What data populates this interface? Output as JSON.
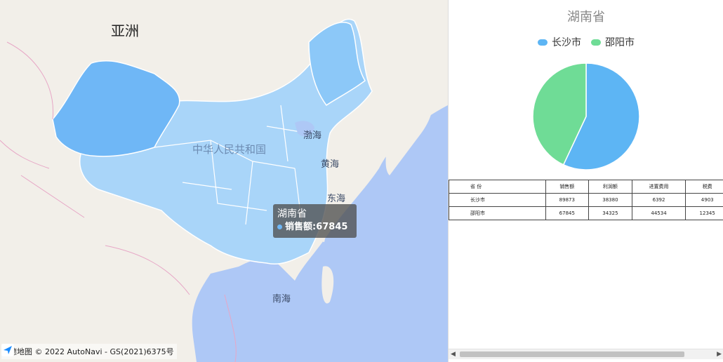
{
  "map": {
    "labels": {
      "asia": "亚洲",
      "country": "中华人民共和国",
      "bohai": "渤海",
      "yellow_sea": "黄海",
      "east_sea": "东海",
      "south_sea": "南海"
    },
    "tooltip": {
      "title": "湖南省",
      "row": "销售额:67845"
    },
    "attribution": {
      "brand": "高德地图",
      "copyright": "© 2022 AutoNavi - GS(2021)6375号"
    },
    "colors": {
      "ocean": "#aec8f6",
      "land": "#f2efe9",
      "region_light": "#a9d5f9",
      "region_dark": "#6fb7f6"
    }
  },
  "chart_data": {
    "type": "pie",
    "title": "湖南省",
    "legend": [
      "长沙市",
      "邵阳市"
    ],
    "legend_position": "top",
    "slices": [
      {
        "name": "长沙市",
        "value": 89873,
        "color": "#5db5f4"
      },
      {
        "name": "邵阳市",
        "value": 67845,
        "color": "#6fdc96"
      }
    ]
  },
  "table": {
    "headers": [
      "省 份",
      "销售额",
      "利润额",
      "进置费用",
      "税费"
    ],
    "rows": [
      [
        "长沙市",
        "89873",
        "38380",
        "6392",
        "4903"
      ],
      [
        "邵阳市",
        "67845",
        "34325",
        "44534",
        "12345"
      ]
    ]
  }
}
